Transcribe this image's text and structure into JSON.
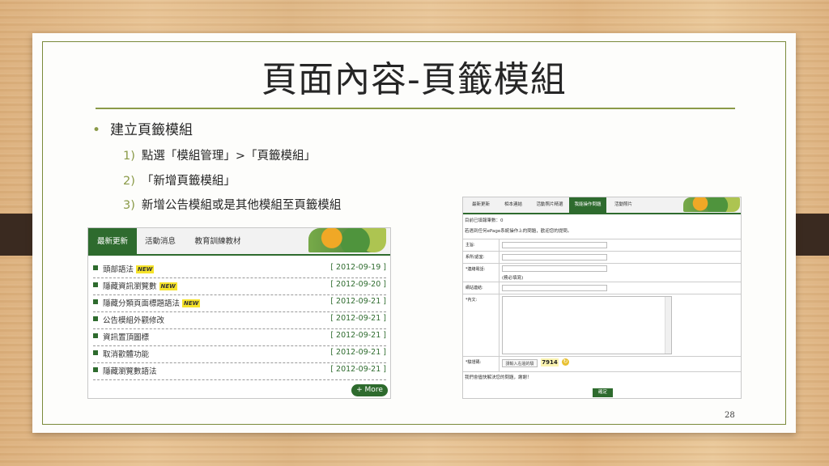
{
  "slide": {
    "title": "頁面內容-頁籤模組",
    "bullet": "建立頁籤模組",
    "steps": [
      {
        "num": "1)",
        "text": "點選「模組管理」>「頁籤模組」"
      },
      {
        "num": "2)",
        "text": "「新增頁籤模組」"
      },
      {
        "num": "3)",
        "text": "新增公告模組或是其他模組至頁籤模組"
      }
    ],
    "page_number": "28"
  },
  "left_shot": {
    "tabs": [
      "最新更新",
      "活動消息",
      "教育訓練教材"
    ],
    "new_badge": "NEW",
    "news": [
      {
        "title": "頭部語法",
        "new": true,
        "date": "[ 2012-09-19 ]"
      },
      {
        "title": "隱藏資訊瀏覽數",
        "new": true,
        "date": "[ 2012-09-20 ]"
      },
      {
        "title": "隱藏分類頁面標題語法",
        "new": true,
        "date": "[ 2012-09-21 ]"
      },
      {
        "title": "公告模組外觀修改",
        "new": false,
        "date": "[ 2012-09-21 ]"
      },
      {
        "title": "資訊置頂圖標",
        "new": false,
        "date": "[ 2012-09-21 ]"
      },
      {
        "title": "取消歡體功能",
        "new": false,
        "date": "[ 2012-09-21 ]"
      },
      {
        "title": "隱藏瀏覽數語法",
        "new": false,
        "date": "[ 2012-09-21 ]"
      }
    ],
    "more_label": "+ More"
  },
  "right_shot": {
    "tabs": [
      "最新更新",
      "相本連結",
      "活動照片精選",
      "我能操作問題",
      "活動照片"
    ],
    "info_line": "目前已填報筆數：0",
    "hint_line": "若遇到任何ePage系統操作上的問題，歡迎您的提問。",
    "fields": [
      {
        "label": "主旨:"
      },
      {
        "label": "系所/處室:"
      },
      {
        "label": "*連絡電話:",
        "note": "(務必填寫)"
      },
      {
        "label": "網站連結:"
      },
      {
        "label": "*內文:"
      },
      {
        "label": "*驗證碼:"
      }
    ],
    "captcha_placeholder": "請輸入右邊的驗",
    "captcha_code": "7914",
    "captcha_refresh": "↻",
    "footer_note": "我們會儘快解決您的問題，謝謝！",
    "submit_label": "確定"
  }
}
